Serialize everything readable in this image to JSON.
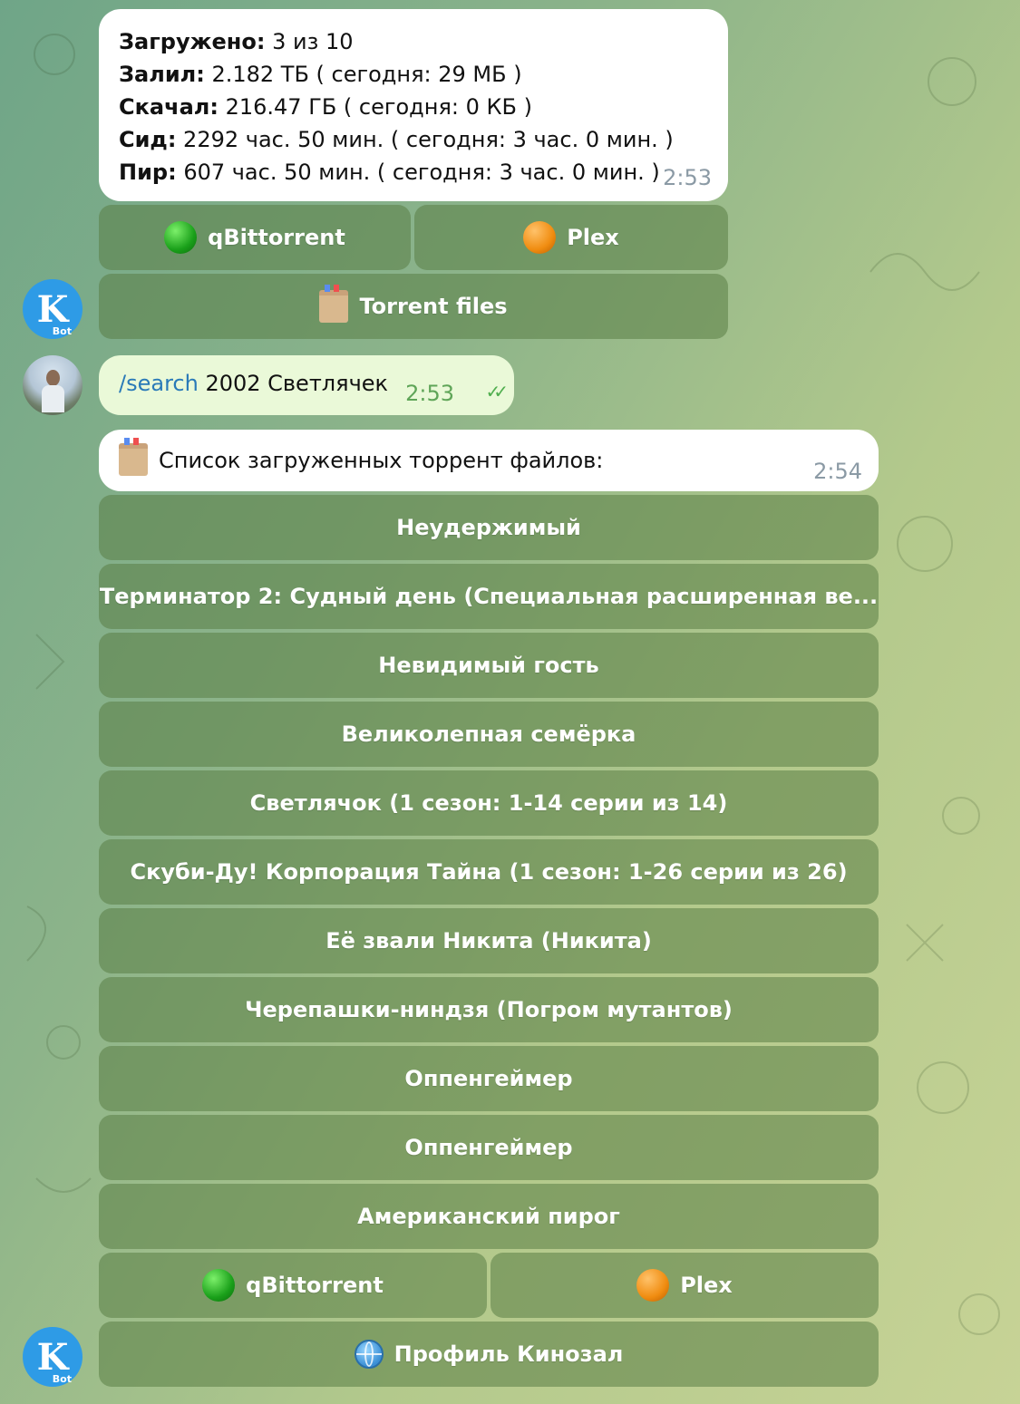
{
  "stats_message": {
    "lines": [
      {
        "key": "Загружено:",
        "value": " 3 из 10"
      },
      {
        "key": "Залил:",
        "value": " 2.182 ТБ ( сегодня: 29 МБ )"
      },
      {
        "key": "Скачал:",
        "value": " 216.47 ГБ ( сегодня: 0 КБ )"
      },
      {
        "key": "Сид:",
        "value": " 2292 час. 50 мин. ( сегодня: 3 час. 0 мин. )"
      },
      {
        "key": "Пир:",
        "value": " 607 час. 50 мин. ( сегодня: 3 час. 0 мин. )"
      }
    ],
    "time": "2:53"
  },
  "keyboard1": {
    "qbittorrent": "qBittorrent",
    "plex": "Plex",
    "torrent_files": "Torrent files"
  },
  "outgoing": {
    "command": "/search",
    "text": " 2002 Светлячек",
    "time": "2:53"
  },
  "list_message": {
    "text": "Список загруженных торрент файлов:",
    "time": "2:54"
  },
  "torrent_buttons": [
    "Неудержимый",
    "Терминатор 2: Судный день (Специальная расширенная ве...",
    "Невидимый гость",
    "Великолепная семёрка",
    "Светлячок (1 сезон: 1-14 серии из 14)",
    "Скуби-Ду! Корпорация Тайна (1 сезон: 1-26 серии из 26)",
    "Её звали Никита (Никита)",
    "Черепашки-ниндзя (Погром мутантов)",
    "Оппенгеймер",
    "Оппенгеймер",
    "Американский пирог"
  ],
  "keyboard2": {
    "qbittorrent": "qBittorrent",
    "plex": "Plex",
    "profile": "Профиль Кинозал"
  },
  "bot_avatar": {
    "letter": "K",
    "sub": "Bot"
  },
  "colors": {
    "status_green": "#1aa01a",
    "status_orange": "#f08c10",
    "link": "#2a7ab8"
  }
}
